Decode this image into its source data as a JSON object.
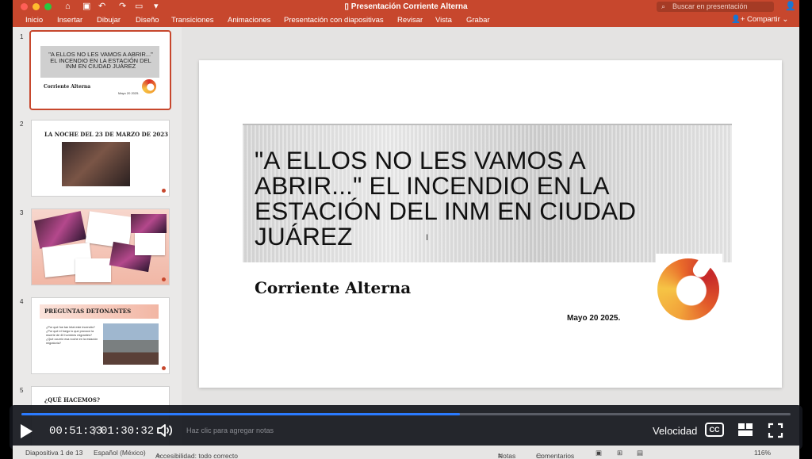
{
  "window": {
    "title": "Presentación Corriente Alterna",
    "search_placeholder": "Buscar en presentación",
    "share_label": "Compartir"
  },
  "ribbon": {
    "tabs": [
      "Inicio",
      "Insertar",
      "Dibujar",
      "Diseño",
      "Transiciones",
      "Animaciones",
      "Presentación con diapositivas",
      "Revisar",
      "Vista",
      "Grabar"
    ]
  },
  "thumbnails": [
    {
      "number": "1",
      "title": "\"A ELLOS NO LES VAMOS A ABRIR...\" EL INCENDIO EN LA ESTACIÓN DEL INM EN CIUDAD JUÁREZ",
      "subtitle": "Corriente Alterna",
      "date": "Mayo 20 2025."
    },
    {
      "number": "2",
      "title": "LA NOCHE DEL 23 DE MARZO DE 2023"
    },
    {
      "number": "3",
      "title": ""
    },
    {
      "number": "4",
      "title": "PREGUNTAS DETONANTES",
      "bullets": [
        "¿Por qué fue tan letal este incendio?",
        "¿Por qué el fuego lo que provocó la muerte de 40 hombres migrantes?",
        "¿Qué ocurrió esa noche en la estación migratoria?"
      ]
    },
    {
      "number": "5",
      "title": "¿QUÉ HACEMOS?"
    }
  ],
  "slide": {
    "title": "\"A ELLOS NO LES VAMOS A ABRIR...\" EL INCENDIO EN LA ESTACIÓN DEL INM EN CIUDAD JUÁREZ",
    "subtitle": "Corriente Alterna",
    "date": "Mayo 20 2025."
  },
  "player": {
    "current_time": "00:51:33",
    "separator": "/",
    "duration": "01:30:32",
    "progress": 0.57,
    "speed_label": "Velocidad",
    "cc_label": "CC",
    "notes_hint": "Haz clic para agregar notas"
  },
  "status": {
    "slide_of": "Diapositiva 1 de 13",
    "language": "Español (México)",
    "accessibility": "Accesibilidad: todo correcto",
    "notes": "Notas",
    "comments": "Comentarios",
    "zoom": "116%"
  },
  "colors": {
    "accent": "#c7472d",
    "progress": "#2b7bff"
  }
}
